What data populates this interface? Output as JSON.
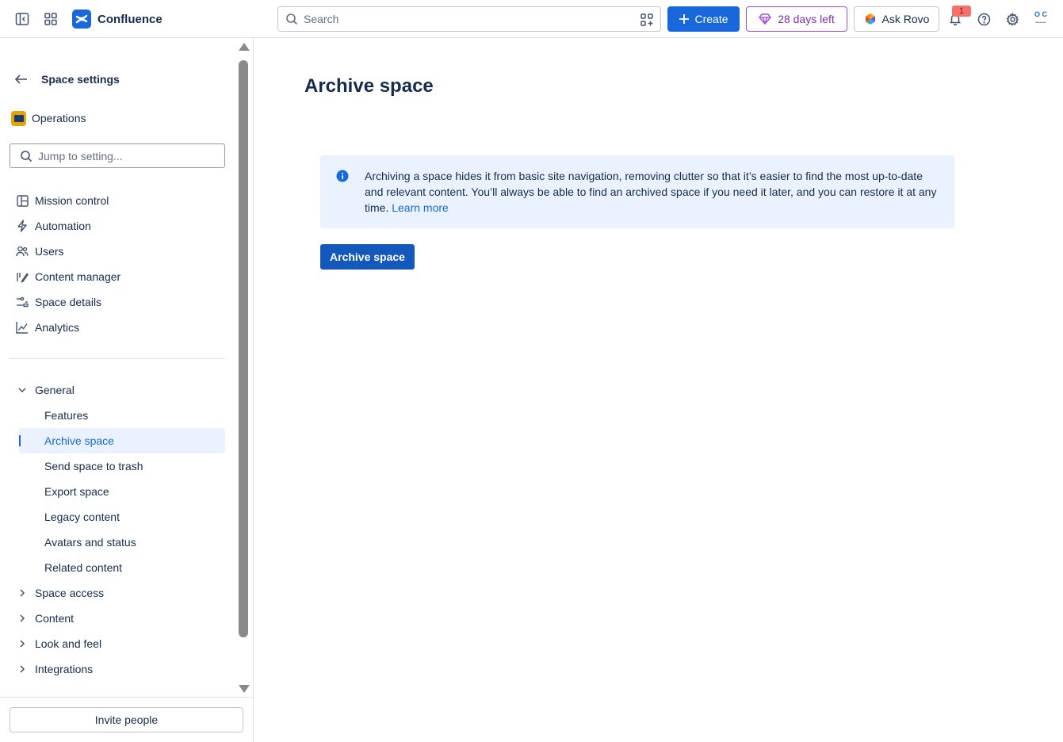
{
  "topbar": {
    "app_name": "Confluence",
    "search_placeholder": "Search",
    "create_label": "Create",
    "trial_label": "28 days left",
    "rovo_label": "Ask Rovo",
    "notification_count": "1",
    "avatar_initials": "O C",
    "icons": [
      "sidebar-toggle-icon",
      "app-switcher-icon",
      "confluence-logo-icon",
      "search-icon",
      "qr-icon",
      "plus-icon",
      "diamond-icon",
      "rovo-icon",
      "bell-icon",
      "help-icon",
      "gear-icon"
    ],
    "colors": {
      "primary": "#1868db",
      "trial": "#7c2ea8",
      "badge": "#f87168"
    }
  },
  "sidebar": {
    "back_title": "Space settings",
    "space_name": "Operations",
    "jump_placeholder": "Jump to setting...",
    "nav_items": [
      {
        "label": "Mission control",
        "icon": "layout-icon"
      },
      {
        "label": "Automation",
        "icon": "lightning-icon"
      },
      {
        "label": "Users",
        "icon": "people-icon"
      },
      {
        "label": "Content manager",
        "icon": "edit-icon"
      },
      {
        "label": "Space details",
        "icon": "sliders-icon"
      },
      {
        "label": "Analytics",
        "icon": "chart-icon"
      }
    ],
    "general": {
      "label": "General",
      "items": [
        {
          "label": "Features"
        },
        {
          "label": "Archive space",
          "active": true
        },
        {
          "label": "Send space to trash"
        },
        {
          "label": "Export space"
        },
        {
          "label": "Legacy content"
        },
        {
          "label": "Avatars and status"
        },
        {
          "label": "Related content"
        }
      ]
    },
    "collapsed_sections": [
      {
        "label": "Space access"
      },
      {
        "label": "Content"
      },
      {
        "label": "Look and feel"
      },
      {
        "label": "Integrations"
      }
    ],
    "invite_label": "Invite people"
  },
  "main": {
    "title": "Archive space",
    "info_text": "Archiving a space hides it from basic site navigation, removing clutter so that it’s easier to find the most up-to-date and relevant content. You’ll always be able to find an archived space if you need it later, and you can restore it at any time.",
    "learn_more": "Learn more",
    "archive_button": "Archive space"
  }
}
